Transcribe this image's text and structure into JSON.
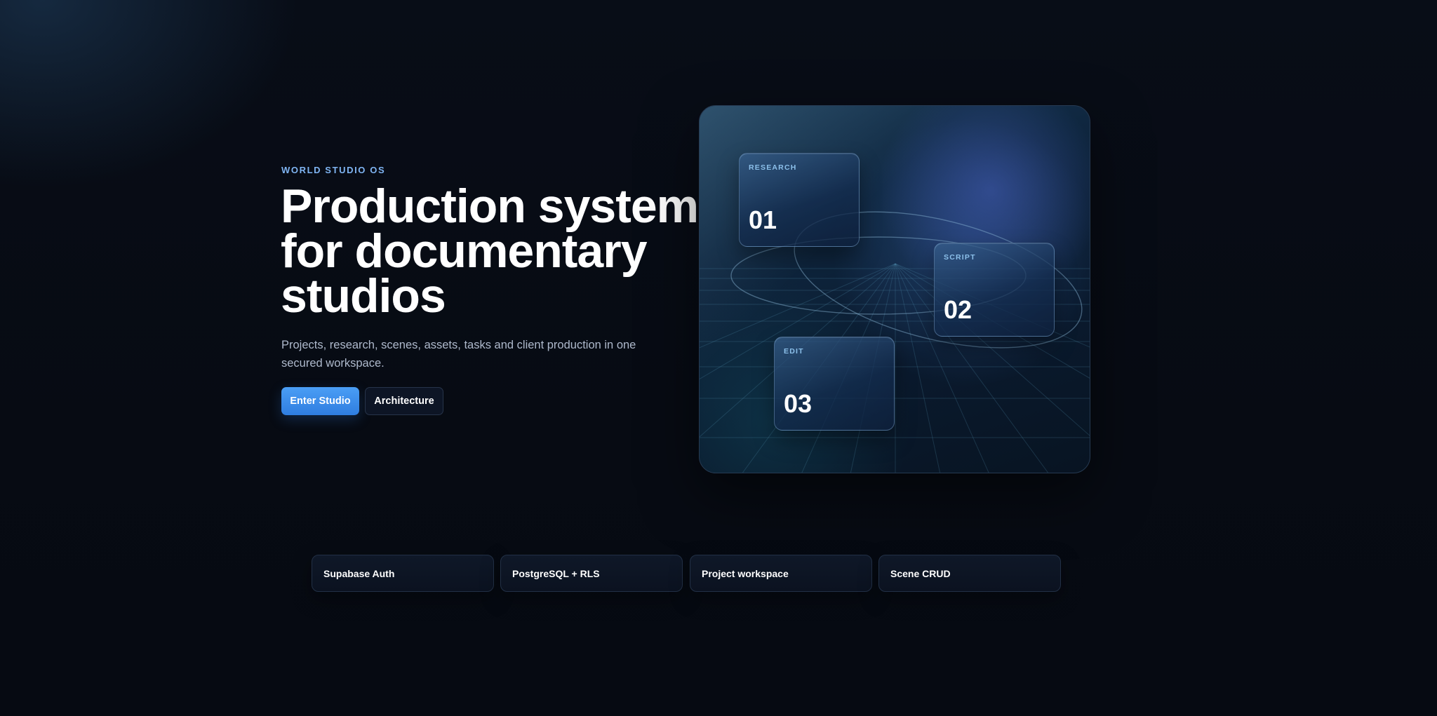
{
  "hero": {
    "eyebrow": "WORLD STUDIO OS",
    "headline": "Production system for documentary studios",
    "subtitle": "Projects, research, scenes, assets, tasks and client production in one secured workspace.",
    "primary_button": "Enter Studio",
    "secondary_button": "Architecture"
  },
  "stages": [
    {
      "label": "RESEARCH",
      "number": "01"
    },
    {
      "label": "SCRIPT",
      "number": "02"
    },
    {
      "label": "EDIT",
      "number": "03"
    }
  ],
  "features": [
    {
      "label": "Supabase Auth"
    },
    {
      "label": "PostgreSQL + RLS"
    },
    {
      "label": "Project workspace"
    },
    {
      "label": "Scene CRUD"
    }
  ],
  "colors": {
    "background": "#070b13",
    "accent": "#3f8ff0",
    "eyebrow": "#7fb4f2",
    "card_label": "#8cc0ea"
  }
}
